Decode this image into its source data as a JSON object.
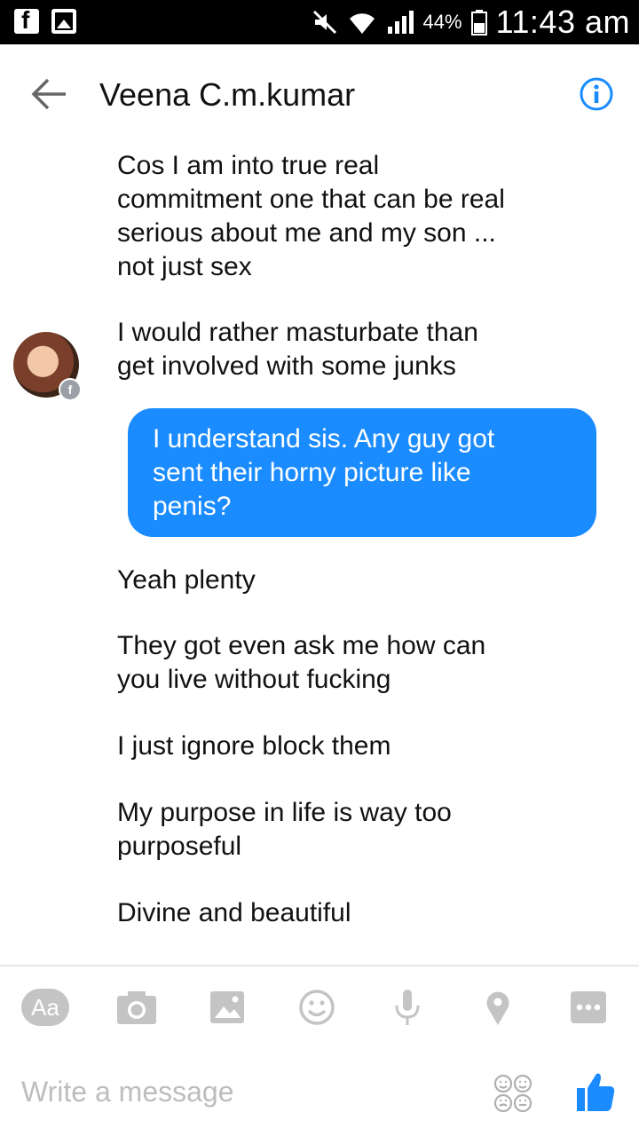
{
  "status_bar": {
    "battery": "44%",
    "time": "11:43 am"
  },
  "header": {
    "title": "Veena C.m.kumar"
  },
  "messages": [
    {
      "from": "them",
      "text_lines": [
        "Cos I am into true real",
        "commitment one that can be real",
        "serious about me and my son ...",
        "not just sex"
      ]
    },
    {
      "from": "them",
      "text_lines": [
        "I would rather masturbate than",
        "get involved with some junks"
      ]
    },
    {
      "from": "me",
      "text_lines": [
        "I understand sis. Any guy got",
        "sent their horny picture like",
        "penis?"
      ]
    },
    {
      "from": "them",
      "text_lines": [
        "Yeah plenty"
      ]
    },
    {
      "from": "them",
      "text_lines": [
        "They got even ask me how can",
        "you live without fucking"
      ]
    },
    {
      "from": "them",
      "text_lines": [
        "I just ignore block them"
      ]
    },
    {
      "from": "them",
      "text_lines": [
        "My purpose in life is way too",
        "purposeful"
      ]
    },
    {
      "from": "them",
      "text_lines": [
        "Divine and beautiful"
      ]
    }
  ],
  "toolbar": {
    "text_button": "Aa",
    "icons": [
      "camera-icon",
      "gallery-icon",
      "emoji-icon",
      "microphone-icon",
      "location-icon",
      "more-icon"
    ]
  },
  "composer": {
    "placeholder": "Write a message"
  },
  "colors": {
    "accent": "#1a8cff",
    "icon_gray": "#c4c4c4"
  }
}
